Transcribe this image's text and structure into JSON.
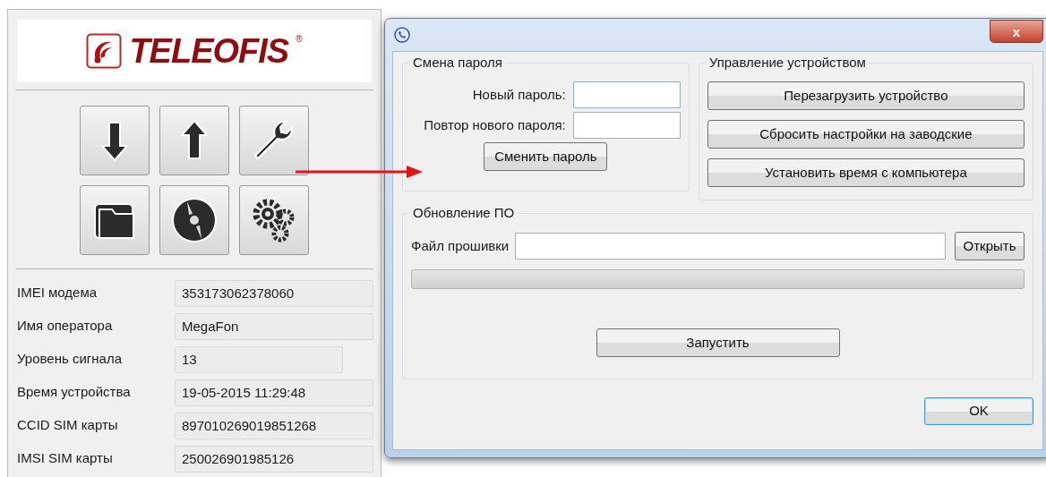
{
  "logo": {
    "name": "TELEOFIS",
    "mark": "®"
  },
  "device_info": [
    {
      "label": "IMEI модема",
      "value": "353173062378060"
    },
    {
      "label": "Имя оператора",
      "value": "MegaFon"
    },
    {
      "label": "Уровень сигнала",
      "value": "13"
    },
    {
      "label": "Время устройства",
      "value": "19-05-2015 11:29:48"
    },
    {
      "label": "CCID SIM карты",
      "value": "897010269019851268"
    },
    {
      "label": "IMSI SIM карты",
      "value": "250026901985126"
    }
  ],
  "dialog": {
    "close": "x",
    "password_group": {
      "title": "Смена пароля",
      "fields": [
        {
          "label": "Новый пароль:",
          "focused": true
        },
        {
          "label": "Повтор нового пароля:",
          "focused": false
        }
      ],
      "button": "Сменить пароль"
    },
    "device_group": {
      "title": "Управление устройством",
      "buttons": [
        "Перезагрузить устройство",
        "Сбросить настройки на заводские",
        "Установить время с компьютера"
      ]
    },
    "firmware_group": {
      "title": "Обновление ПО",
      "file_label": "Файл прошивки",
      "open_button": "Открыть",
      "progress": {
        "level": 0
      },
      "start_button": "Запустить"
    },
    "ok_button": {
      "label": "OK",
      "default": true
    }
  }
}
